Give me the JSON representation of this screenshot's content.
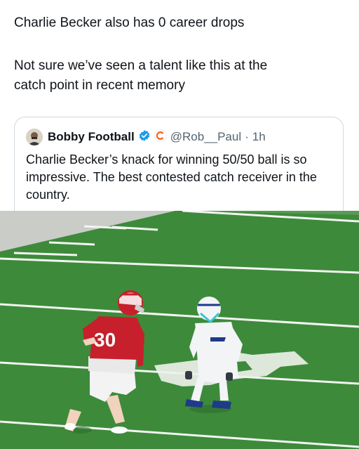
{
  "post": {
    "line1": "Charlie Becker also has 0 career drops",
    "line2": "Not sure we’ve seen a talent like this at the",
    "line3": "catch point in recent memory"
  },
  "quoted": {
    "author_name": "Bobby Football",
    "handle": "@Rob__Paul",
    "separator": "·",
    "time": "1h",
    "text": "Charlie Becker’s knack for winning 50/50 ball is so impressive. The best contested catch receiver in the country."
  },
  "media": {
    "jersey_number": "30",
    "colors": {
      "field": "#3d8a3b",
      "red_jersey": "#c81f2c",
      "white_jersey": "#f2f4f6",
      "verified": "#1d9bf0",
      "team_badge": "#f26722"
    }
  }
}
